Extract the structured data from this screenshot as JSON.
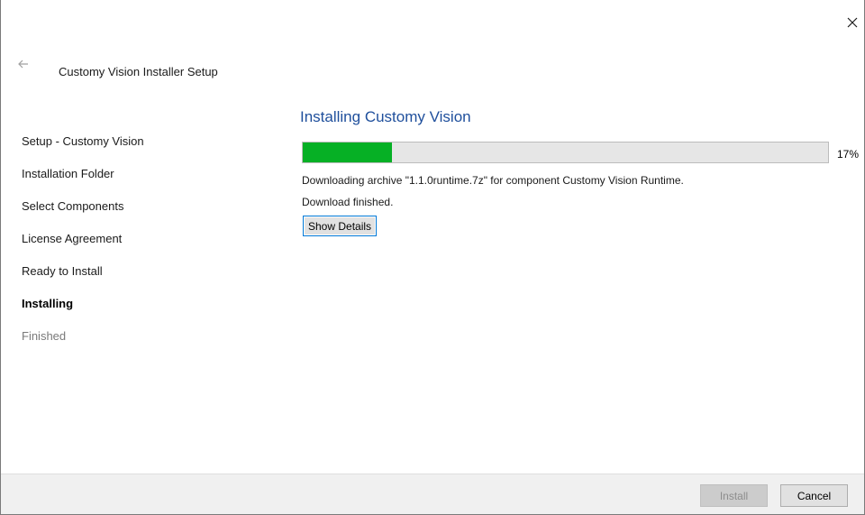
{
  "window": {
    "title": "Customy Vision Installer Setup",
    "close_icon": "close-icon",
    "back_icon": "back-arrow-icon"
  },
  "sidebar": {
    "steps": [
      {
        "label": "Setup - Customy Vision",
        "state": "done"
      },
      {
        "label": "Installation Folder",
        "state": "done"
      },
      {
        "label": "Select Components",
        "state": "done"
      },
      {
        "label": "License Agreement",
        "state": "done"
      },
      {
        "label": "Ready to Install",
        "state": "done"
      },
      {
        "label": "Installing",
        "state": "active"
      },
      {
        "label": "Finished",
        "state": "pending"
      }
    ]
  },
  "main": {
    "heading": "Installing Customy Vision",
    "progress": {
      "percent": 17,
      "percent_label": "17%",
      "fill_color": "#06b025"
    },
    "status_lines": [
      "Downloading archive \"1.1.0runtime.7z\" for component Customy Vision Runtime.",
      "Download finished."
    ],
    "show_details_label": "Show Details"
  },
  "footer": {
    "install_label": "Install",
    "install_enabled": false,
    "cancel_label": "Cancel"
  },
  "colors": {
    "heading": "#1f4f9c",
    "focus_border": "#0078d7",
    "footer_bg": "#f0f0f0"
  }
}
